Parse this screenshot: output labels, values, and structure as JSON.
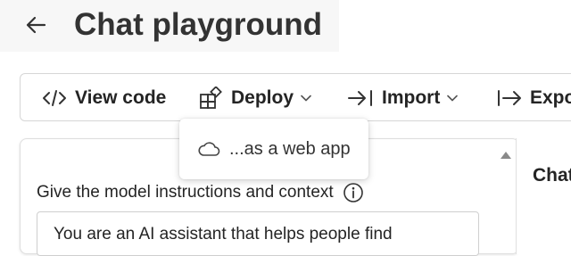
{
  "header": {
    "title": "Chat playground",
    "back_icon": "arrow-left-icon"
  },
  "toolbar": {
    "view_code_label": "View code",
    "deploy_label": "Deploy",
    "import_label": "Import",
    "export_label": "Expo"
  },
  "deploy_menu": {
    "items": [
      {
        "label": "...as a web app",
        "icon": "cloud-icon"
      }
    ]
  },
  "setup_panel": {
    "instructions_label": "Give the model instructions and context",
    "system_message": "You are an AI assistant that helps people find"
  },
  "chat_panel": {
    "title": "Chat"
  }
}
